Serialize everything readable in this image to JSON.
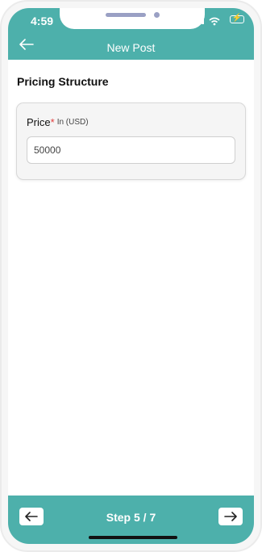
{
  "status_bar": {
    "time": "4:59"
  },
  "header": {
    "title": "New Post",
    "back_icon": "arrow-left-icon"
  },
  "section": {
    "title": "Pricing Structure"
  },
  "price": {
    "label": "Price",
    "required_marker": "*",
    "unit": "In (USD)",
    "value": "50000"
  },
  "footer": {
    "step_text": "Step 5 / 7",
    "prev_icon": "arrow-left-icon",
    "next_icon": "arrow-right-icon"
  },
  "colors": {
    "accent": "#4db0ab",
    "required": "#e23c3c"
  }
}
